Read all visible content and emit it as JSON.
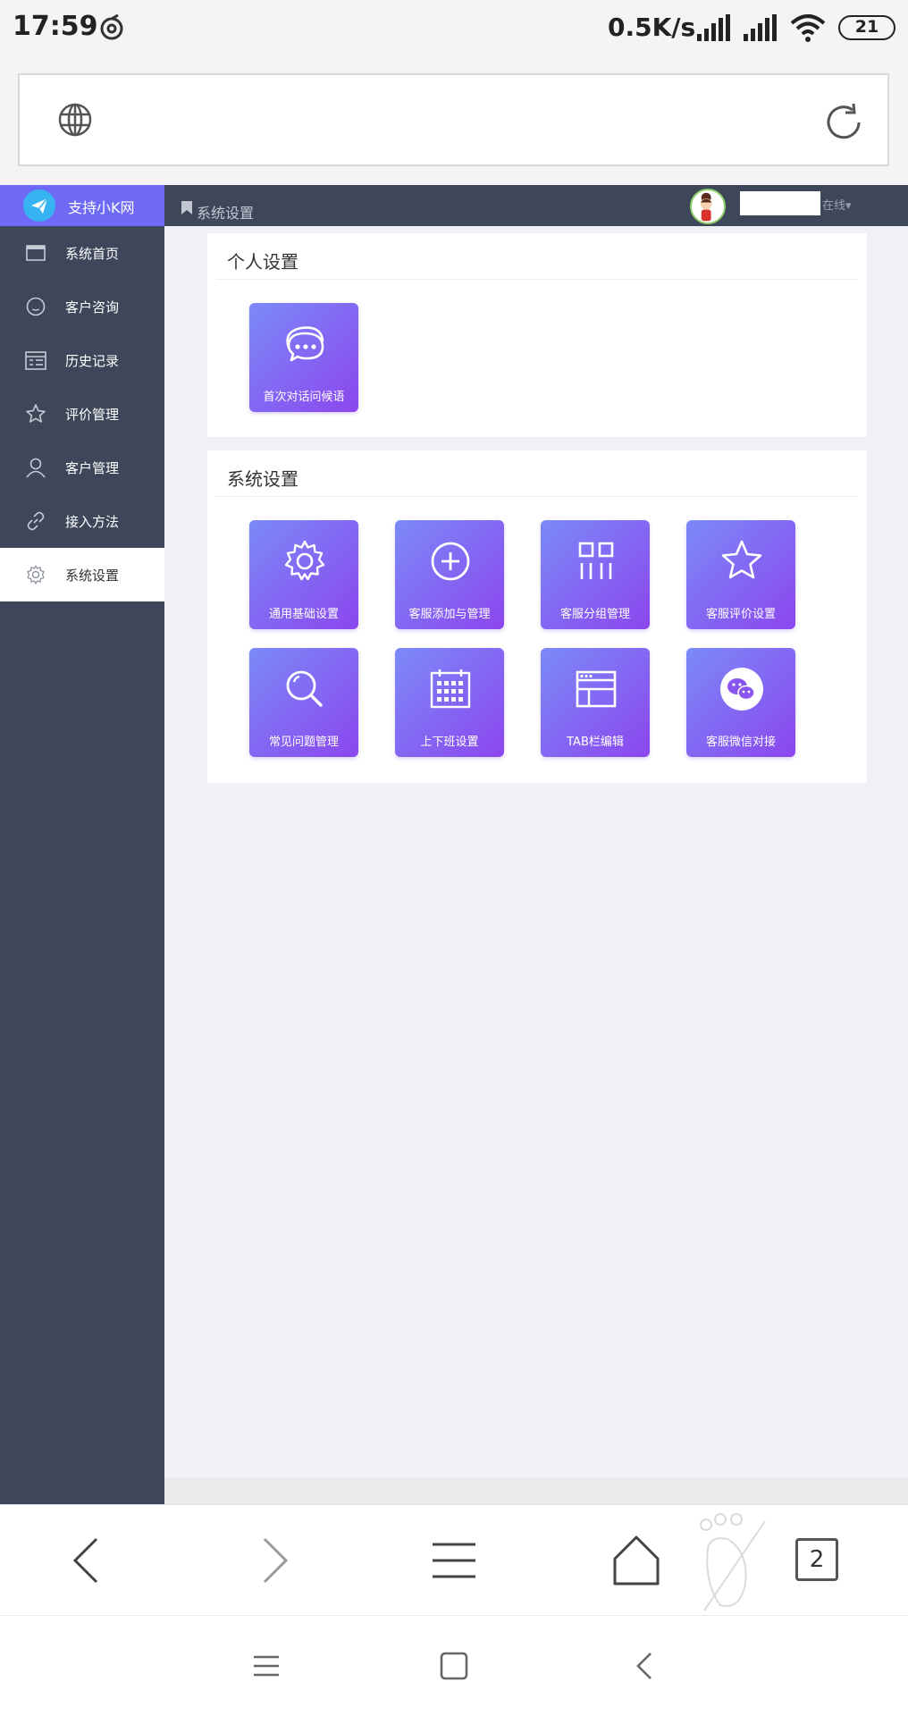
{
  "status_bar": {
    "time": "17:59",
    "net_speed": "0.5K/s",
    "battery": "21"
  },
  "app": {
    "brand_label": "支持小K网",
    "breadcrumb": "系统设置",
    "user_status": "在线▾"
  },
  "sidebar": {
    "items": [
      {
        "label": "系统首页",
        "icon": "window-icon"
      },
      {
        "label": "客户咨询",
        "icon": "chat-bubble-icon"
      },
      {
        "label": "历史记录",
        "icon": "calendar-list-icon"
      },
      {
        "label": "评价管理",
        "icon": "star-icon"
      },
      {
        "label": "客户管理",
        "icon": "user-icon"
      },
      {
        "label": "接入方法",
        "icon": "link-icon"
      },
      {
        "label": "系统设置",
        "icon": "gear-icon",
        "active": true
      }
    ]
  },
  "sections": {
    "personal": {
      "title": "个人设置",
      "tiles": [
        {
          "label": "首次对话问候语",
          "icon": "chat-dots-icon"
        }
      ]
    },
    "system": {
      "title": "系统设置",
      "tiles": [
        {
          "label": "通用基础设置",
          "icon": "gear-icon"
        },
        {
          "label": "客服添加与管理",
          "icon": "plus-circle-icon"
        },
        {
          "label": "客服分组管理",
          "icon": "grid-bars-icon"
        },
        {
          "label": "客服评价设置",
          "icon": "star-icon"
        },
        {
          "label": "常见问题管理",
          "icon": "search-icon"
        },
        {
          "label": "上下班设置",
          "icon": "calendar-icon"
        },
        {
          "label": "TAB栏编辑",
          "icon": "browser-window-icon"
        },
        {
          "label": "客服微信对接",
          "icon": "wechat-icon"
        }
      ]
    }
  },
  "browser_bar": {
    "tab_count": "2"
  },
  "colors": {
    "sidebar_bg": "#3d4759",
    "brand_bg": "#6f6af5",
    "tile_gradient_start": "#7b8af8",
    "tile_gradient_end": "#8c46ee"
  }
}
